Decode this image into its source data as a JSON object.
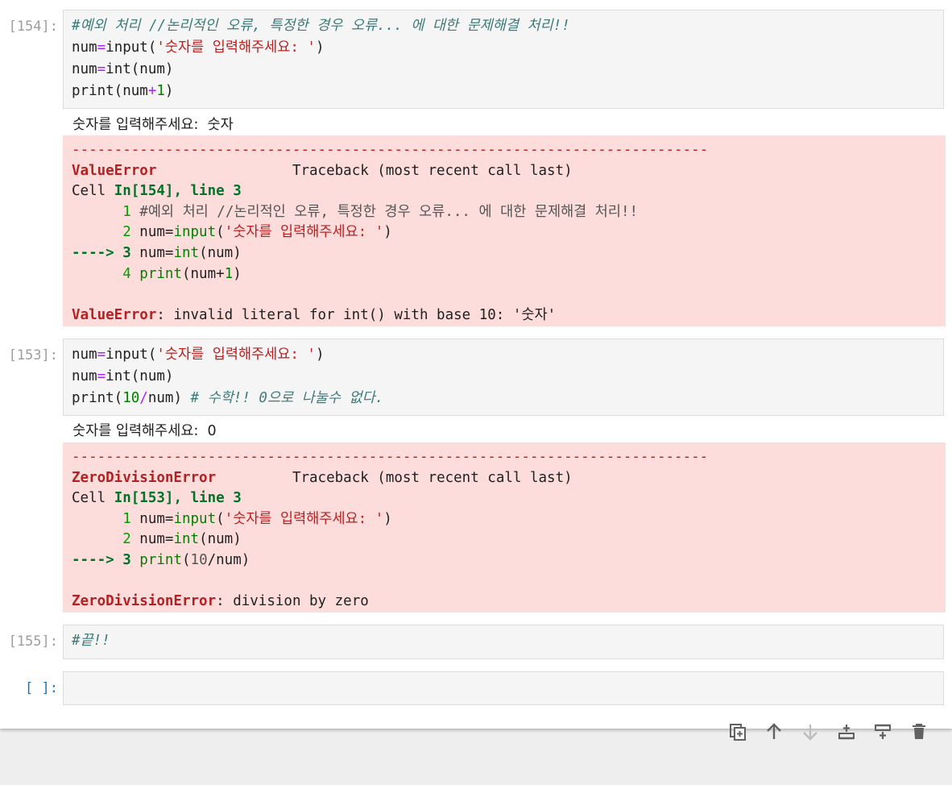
{
  "cells": [
    {
      "prompt": "[154]:",
      "code": [
        "#예외 처리 //논리적인 오류, 특정한 경우 오류... 에 대한 문제해결 처리!!",
        "num=input('숫자를 입력해주세요: ')",
        "num=int(num)",
        "print(num+1)"
      ],
      "stdout": "숫자를 입력해주세요:  숫자",
      "traceback": {
        "separator": "---------------------------------------------------------------------------",
        "error_name": "ValueError",
        "traceback_label": "Traceback (most recent call last)",
        "cell_ref_prefix": "Cell ",
        "cell_ref": "In[154], line 3",
        "lines": [
          {
            "marker": "      1 ",
            "text": "#예외 처리 //논리적인 오류, 특정한 경우 오류... 에 대한 문제해결 처리!!"
          },
          {
            "marker": "      2 ",
            "text": "num=input('숫자를 입력해주세요: ')"
          },
          {
            "marker": "----> 3 ",
            "text": "num=int(num)"
          },
          {
            "marker": "      4 ",
            "text": "print(num+1)"
          }
        ],
        "final_name": "ValueError",
        "final_message": ": invalid literal for int() with base 10: '숫자'"
      }
    },
    {
      "prompt": "[153]:",
      "code": [
        "num=input('숫자를 입력해주세요: ')",
        "num=int(num)",
        "print(10/num) # 수학!! 0으로 나눌수 없다."
      ],
      "stdout": "숫자를 입력해주세요:  0",
      "traceback": {
        "separator": "---------------------------------------------------------------------------",
        "error_name": "ZeroDivisionError",
        "traceback_label": "Traceback (most recent call last)",
        "cell_ref_prefix": "Cell ",
        "cell_ref": "In[153], line 3",
        "lines": [
          {
            "marker": "      1 ",
            "text": "num=input('숫자를 입력해주세요: ')"
          },
          {
            "marker": "      2 ",
            "text": "num=int(num)"
          },
          {
            "marker": "----> 3 ",
            "text": "print(10/num)"
          }
        ],
        "final_name": "ZeroDivisionError",
        "final_message": ": division by zero"
      }
    },
    {
      "prompt": "[155]:",
      "code": [
        "#끝!!"
      ]
    },
    {
      "prompt": "[ ]:",
      "code": [
        ""
      ]
    }
  ],
  "toolbar_icons": [
    "duplicate-icon",
    "move-up-icon",
    "move-down-icon",
    "insert-above-icon",
    "insert-below-icon",
    "delete-icon"
  ]
}
